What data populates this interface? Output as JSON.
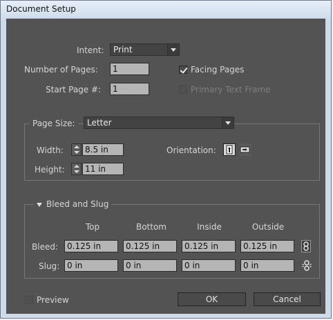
{
  "window": {
    "title": "Document Setup"
  },
  "setup": {
    "intent_label": "Intent:",
    "intent_value": "Print",
    "num_pages_label": "Number of Pages:",
    "num_pages_value": "1",
    "start_page_label": "Start Page #:",
    "start_page_value": "1",
    "facing_pages_label": "Facing Pages",
    "facing_pages_checked": true,
    "primary_text_frame_label": "Primary Text Frame",
    "primary_text_frame_checked": false
  },
  "page_size": {
    "label": "Page Size:",
    "value": "Letter",
    "width_label": "Width:",
    "width_value": "8.5 in",
    "height_label": "Height:",
    "height_value": "11 in",
    "orientation_label": "Orientation:",
    "orientation_selected": "portrait"
  },
  "bleed_slug": {
    "header": "Bleed and Slug",
    "columns": [
      "Top",
      "Bottom",
      "Inside",
      "Outside"
    ],
    "bleed_label": "Bleed:",
    "bleed_values": [
      "0.125 in",
      "0.125 in",
      "0.125 in",
      "0.125 in"
    ],
    "slug_label": "Slug:",
    "slug_values": [
      "0 in",
      "0 in",
      "0 in",
      "0 in"
    ]
  },
  "footer": {
    "preview_label": "Preview",
    "preview_checked": false,
    "ok_label": "OK",
    "cancel_label": "Cancel"
  },
  "icons": {
    "intent_arrow": "chevron-down-icon",
    "page_size_arrow": "chevron-down-icon",
    "portrait": "portrait-orientation-icon",
    "landscape": "landscape-orientation-icon",
    "bleed_link": "chain-link-icon",
    "slug_link": "broken-chain-link-icon",
    "disclosure": "triangle-down-icon"
  },
  "colors": {
    "panel_bg": "#535353",
    "field_bg": "#b5b5b5",
    "title_bg": "#dbe6f2"
  }
}
